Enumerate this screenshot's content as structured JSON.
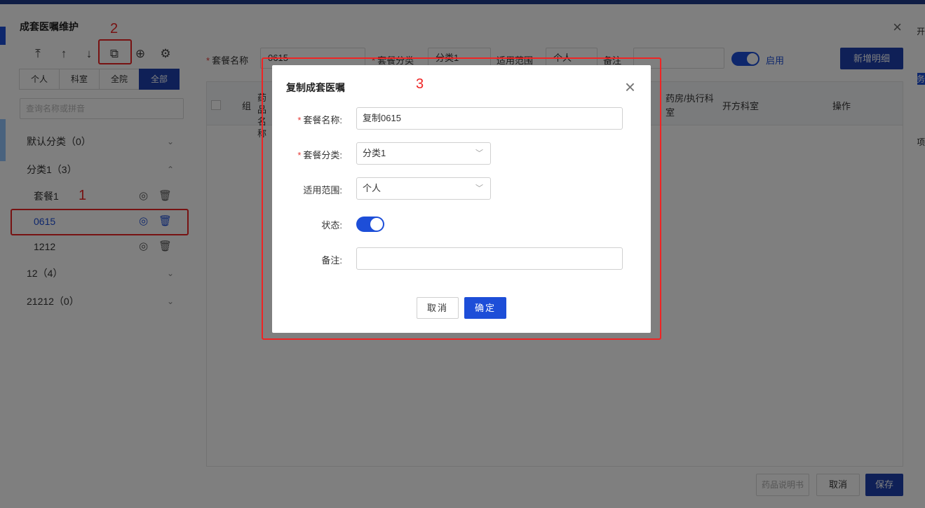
{
  "background": {
    "right_edge_texts": [
      "开",
      "务",
      "项"
    ],
    "outer_dialog": {
      "title": "成套医嘱维护",
      "close": "×",
      "toolbar": [
        "⤒",
        "↑",
        "↓",
        "⧉",
        "⊕",
        "⚙"
      ],
      "scope_tabs": [
        "个人",
        "科室",
        "全院",
        "全部"
      ],
      "active_scope": "全部",
      "search_placeholder": "查询名称或拼音",
      "tree": [
        {
          "label": "默认分类（0）",
          "chev": "⌄"
        },
        {
          "label": "分类1（3）",
          "chev": "⌃"
        },
        {
          "label": "套餐1",
          "child": true
        },
        {
          "label": "0615",
          "child": true,
          "selected": true
        },
        {
          "label": "1212",
          "child": true
        },
        {
          "label": "12（4）",
          "chev": "⌄"
        },
        {
          "label": "21212（0）",
          "chev": "⌄"
        }
      ],
      "form": {
        "name_label": "套餐名称",
        "name_value": "0615",
        "category_label": "套餐分类",
        "category_value": "分类1",
        "scope_label": "适用范围",
        "scope_value": "个人",
        "remark_label": "备注",
        "enable_label": "启用",
        "add_detail": "新增明细"
      },
      "table_headers": [
        "组",
        "药品名称",
        "药房/执行科室",
        "开方科室",
        "操作"
      ],
      "footer": {
        "manual": "药品说明书",
        "cancel": "取消",
        "save": "保存"
      }
    }
  },
  "annotations": [
    "1",
    "2",
    "3"
  ],
  "modal": {
    "title": "复制成套医嘱",
    "close": "×",
    "fields": {
      "name_label": "套餐名称:",
      "name_value": "复制0615",
      "category_label": "套餐分类:",
      "category_value": "分类1",
      "scope_label": "适用范围:",
      "scope_value": "个人",
      "status_label": "状态:",
      "remark_label": "备注:",
      "remark_value": ""
    },
    "cancel": "取消",
    "ok": "确定"
  },
  "colors": {
    "primary": "#1d4ed8",
    "highlight": "#ef2424",
    "dark_primary": "#1e40af"
  }
}
